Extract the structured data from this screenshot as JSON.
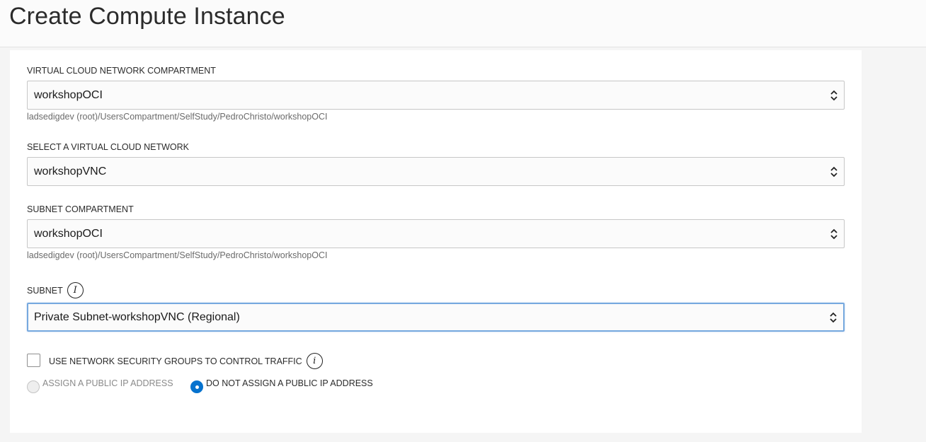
{
  "page": {
    "title": "Create Compute Instance"
  },
  "form": {
    "vcn_compartment": {
      "label": "VIRTUAL CLOUD NETWORK COMPARTMENT",
      "value": "workshopOCI",
      "helper": "ladsedigdev (root)/UsersCompartment/SelfStudy/PedroChristo/workshopOCI"
    },
    "vcn": {
      "label": "SELECT A VIRTUAL CLOUD NETWORK",
      "value": "workshopVNC"
    },
    "subnet_compartment": {
      "label": "SUBNET COMPARTMENT",
      "value": "workshopOCI",
      "helper": "ladsedigdev (root)/UsersCompartment/SelfStudy/PedroChristo/workshopOCI"
    },
    "subnet": {
      "label": "SUBNET",
      "value": "Private Subnet-workshopVNC (Regional)"
    },
    "nsg_checkbox": {
      "label": "USE NETWORK SECURITY GROUPS TO CONTROL TRAFFIC",
      "checked": false
    },
    "public_ip": {
      "options": [
        {
          "label": "ASSIGN A PUBLIC IP ADDRESS",
          "selected": false,
          "disabled": true
        },
        {
          "label": "DO NOT ASSIGN A PUBLIC IP ADDRESS",
          "selected": true,
          "disabled": false
        }
      ]
    }
  },
  "colors": {
    "accent": "#0572ce",
    "focus_border": "#76a9df"
  }
}
